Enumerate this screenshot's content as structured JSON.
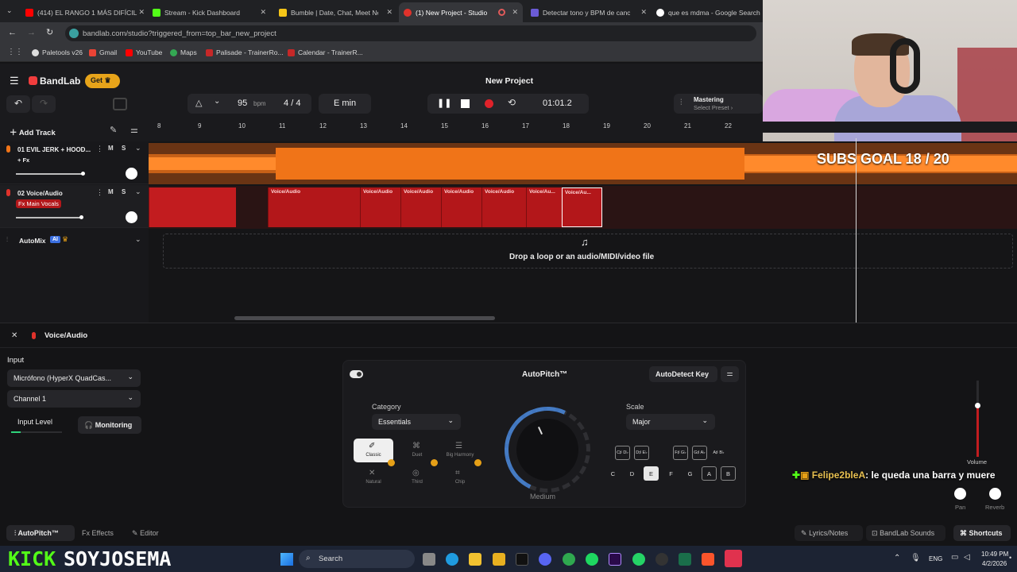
{
  "browser": {
    "tabs": [
      {
        "label": "(414) EL RANGO 1 MÁS DIFÍCIL",
        "color": "#ff0000"
      },
      {
        "label": "Stream - Kick Dashboard",
        "color": "#53fc18"
      },
      {
        "label": "Bumble | Date, Chat, Meet New",
        "color": "#f5c518"
      },
      {
        "label": "(1) New Project - Studio",
        "color": "#e0322b"
      },
      {
        "label": "Detectar tono y BPM de canción",
        "color": "#6b5bd6"
      },
      {
        "label": "que es mdma - Google Search",
        "color": "#ffffff"
      }
    ],
    "url": "bandlab.com/studio?triggered_from=top_bar_new_project",
    "bookmarks": [
      "Paletools v26",
      "Gmail",
      "YouTube",
      "Maps",
      "Palisade - TrainerRo...",
      "Calendar - TrainerR..."
    ]
  },
  "app": {
    "brand": "BandLab",
    "get_label": "Get",
    "project_title": "New Project",
    "bpm": "95",
    "bpm_unit": "bpm",
    "time_sig_num": "4",
    "time_sig_sep": "/",
    "time_sig_den": "4",
    "key": "E min",
    "time": "01:01.2",
    "mastering_label": "Mastering",
    "mastering_sub": "Select Preset",
    "add_track": "Add Track",
    "ruler": [
      "8",
      "9",
      "10",
      "11",
      "12",
      "13",
      "14",
      "15",
      "16",
      "17",
      "18",
      "19",
      "20",
      "21",
      "22"
    ],
    "tracks": [
      {
        "name": "01  EVIL JERK + HOOD...",
        "fx": "+ Fx",
        "mute": "M",
        "solo": "S",
        "color": "#f07418"
      },
      {
        "name": "02  Voice/Audio",
        "fx": "Fx Main Vocals",
        "mute": "M",
        "solo": "S",
        "color": "#c21c1f"
      }
    ],
    "clips": [
      "Voice/Audio",
      "Voice/Audio",
      "Voice/Audio",
      "Voice/Audio",
      "Voice/Audio",
      "Voice/Au...",
      "Voice/Au..."
    ],
    "automix": "AutoMix",
    "automix_badge": "AI",
    "drop_text": "Drop a loop or an audio/MIDI/video file",
    "overlay_subs": "SUBS GOAL 18 / 20"
  },
  "panel": {
    "track_name": "Voice/Audio",
    "input_label": "Input",
    "input_device": "Micrófono (HyperX QuadCas...",
    "channel": "Channel 1",
    "input_level": "Input Level",
    "monitoring": "Monitoring",
    "autopitch_title": "AutoPitch™",
    "autodetect": "AutoDetect Key",
    "category_label": "Category",
    "category_value": "Essentials",
    "scale_label": "Scale",
    "scale_value": "Major",
    "knob_label": "Medium",
    "presets": [
      "Classic",
      "Duet",
      "Big Harmony",
      "Natural",
      "Third",
      "Chip"
    ],
    "sharp_keys": [
      "C♯ D♭",
      "D♯ E♭",
      "F♯ G♭",
      "G♯ A♭",
      "A♯ B♭"
    ],
    "keys": [
      "C",
      "D",
      "E",
      "F",
      "G",
      "A",
      "B"
    ],
    "volume": "Volume",
    "pan": "Pan",
    "reverb": "Reverb",
    "tabs": [
      "AutoPitch™",
      "Effects",
      "Editor"
    ],
    "right_buttons": [
      "Lyrics/Notes",
      "BandLab Sounds",
      "Shortcuts"
    ]
  },
  "chat": {
    "user": "Felipe2bleA",
    "message": ": le queda una barra y muere"
  },
  "stream": {
    "kick": "KICK",
    "channel": "SOYJOSEMA"
  },
  "taskbar": {
    "search": "Search",
    "lang": "ENG",
    "time": "10:49 PM",
    "date": "4/2/2026"
  }
}
